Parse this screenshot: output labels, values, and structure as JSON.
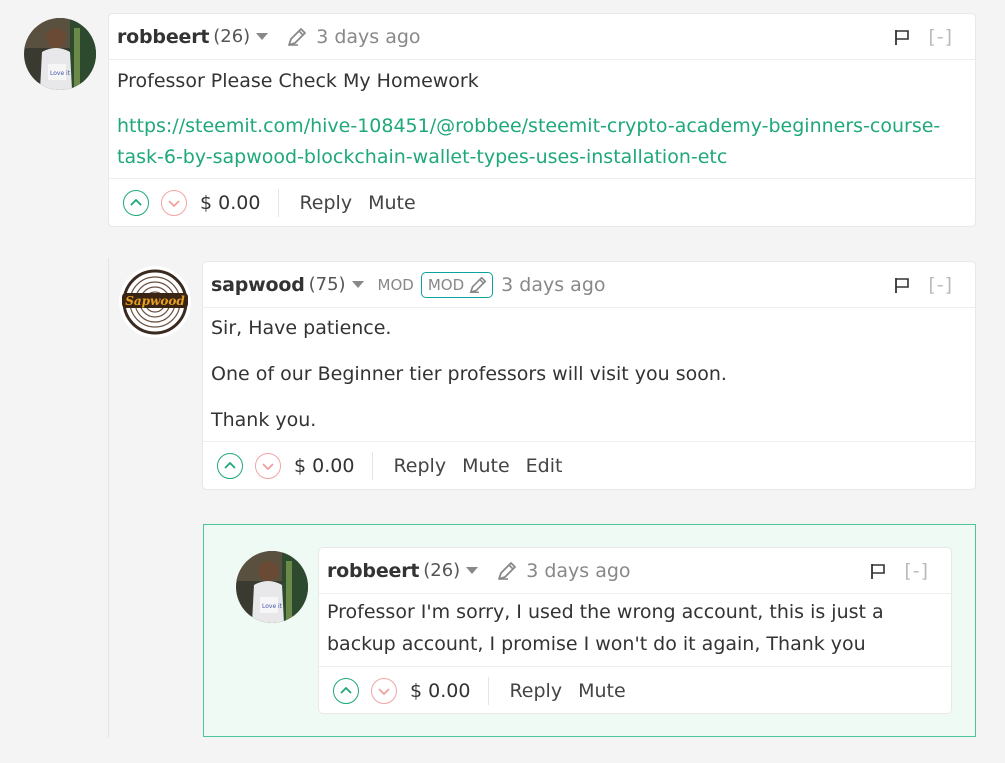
{
  "comments": [
    {
      "author": "robbeert",
      "reputation": "(26)",
      "time": "3 days ago",
      "collapse": "[-]",
      "body": "Professor Please Check My Homework",
      "link": "https://steemit.com/hive-108451/@robbee/steemit-crypto-academy-beginners-course-task-6-by-sapwood-blockchain-wallet-types-uses-installation-etc",
      "payout": "$ 0.00",
      "actions": [
        "Reply",
        "Mute"
      ]
    },
    {
      "author": "sapwood",
      "reputation": "(75)",
      "mod_label": "MOD",
      "mod_badge": "MOD",
      "time": "3 days ago",
      "collapse": "[-]",
      "avatar_text": "Sapwood",
      "paragraphs": [
        "Sir, Have patience.",
        "One of our Beginner tier professors will visit you soon.",
        "Thank you."
      ],
      "payout": "$ 0.00",
      "actions": [
        "Reply",
        "Mute",
        "Edit"
      ]
    },
    {
      "author": "robbeert",
      "reputation": "(26)",
      "time": "3 days ago",
      "collapse": "[-]",
      "body": "Professor I'm sorry, I used the wrong account, this is just a backup account, I promise I won't do it again, Thank you",
      "payout": "$ 0.00",
      "actions": [
        "Reply",
        "Mute"
      ]
    }
  ],
  "colors": {
    "upvote": "#1fa87b",
    "downvote": "#f2a5a5",
    "link": "#1fa87b",
    "highlight_border": "#4fc49a",
    "mod_badge": "#0fa0a0"
  }
}
